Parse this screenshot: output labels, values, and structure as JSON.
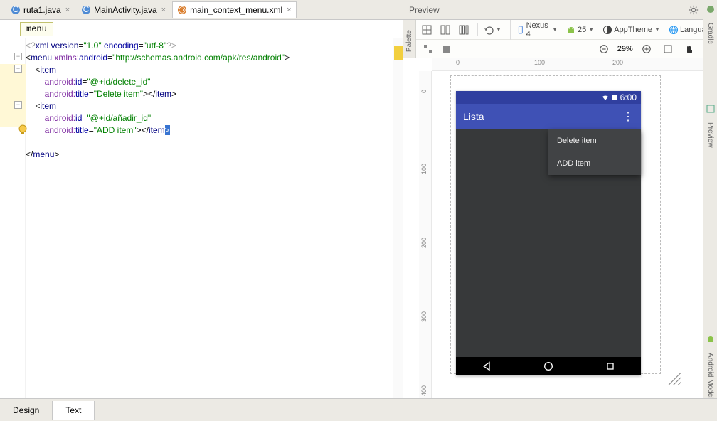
{
  "tabs": [
    {
      "label": "ruta1.java",
      "icon_hint": "class"
    },
    {
      "label": "MainActivity.java",
      "icon_hint": "class"
    },
    {
      "label": "main_context_menu.xml",
      "icon_hint": "xml"
    }
  ],
  "active_tab_index": 2,
  "breadcrumb": {
    "item": "menu"
  },
  "editor": {
    "selection_text": ">",
    "lines_tokens": [
      [
        {
          "cls": "t-pi",
          "t": "<?"
        },
        {
          "cls": "t-tag",
          "t": "xml version"
        },
        {
          "cls": "",
          "t": "="
        },
        {
          "cls": "t-str",
          "t": "\"1.0\""
        },
        {
          "cls": "",
          "t": " "
        },
        {
          "cls": "t-attr",
          "t": "encoding"
        },
        {
          "cls": "",
          "t": "="
        },
        {
          "cls": "t-str",
          "t": "\"utf-8\""
        },
        {
          "cls": "t-pi",
          "t": "?>"
        }
      ],
      [
        {
          "cls": "",
          "t": "<"
        },
        {
          "cls": "t-tag",
          "t": "menu "
        },
        {
          "cls": "t-ns",
          "t": "xmlns:"
        },
        {
          "cls": "t-attr",
          "t": "android"
        },
        {
          "cls": "",
          "t": "="
        },
        {
          "cls": "t-str",
          "t": "\"http://schemas.android.com/apk/res/android\""
        },
        {
          "cls": "",
          "t": ">"
        }
      ],
      [
        {
          "cls": "",
          "t": "    <"
        },
        {
          "cls": "t-tag",
          "t": "item"
        }
      ],
      [
        {
          "cls": "",
          "t": "        "
        },
        {
          "cls": "t-ns",
          "t": "android:"
        },
        {
          "cls": "t-attr",
          "t": "id"
        },
        {
          "cls": "",
          "t": "="
        },
        {
          "cls": "t-str",
          "t": "\"@+id/delete_id\""
        }
      ],
      [
        {
          "cls": "",
          "t": "        "
        },
        {
          "cls": "t-ns",
          "t": "android:"
        },
        {
          "cls": "t-attr",
          "t": "title"
        },
        {
          "cls": "",
          "t": "="
        },
        {
          "cls": "t-str",
          "t": "\"Delete item\""
        },
        {
          "cls": "",
          "t": "></"
        },
        {
          "cls": "t-tag",
          "t": "item"
        },
        {
          "cls": "",
          "t": ">"
        }
      ],
      [
        {
          "cls": "",
          "t": "    <"
        },
        {
          "cls": "t-tag",
          "t": "item"
        }
      ],
      [
        {
          "cls": "",
          "t": "        "
        },
        {
          "cls": "t-ns",
          "t": "android:"
        },
        {
          "cls": "t-attr",
          "t": "id"
        },
        {
          "cls": "",
          "t": "="
        },
        {
          "cls": "t-str",
          "t": "\"@+id/añadir_id\""
        }
      ],
      [
        {
          "cls": "",
          "t": "        "
        },
        {
          "cls": "t-ns",
          "t": "android:"
        },
        {
          "cls": "t-attr",
          "t": "title"
        },
        {
          "cls": "",
          "t": "="
        },
        {
          "cls": "t-str",
          "t": "\"ADD item\""
        },
        {
          "cls": "",
          "t": "></"
        },
        {
          "cls": "t-tag",
          "t": "item"
        },
        {
          "cls": "sel",
          "t": ">"
        }
      ],
      [
        {
          "cls": "",
          "t": ""
        }
      ],
      [
        {
          "cls": "",
          "t": "</"
        },
        {
          "cls": "t-tag",
          "t": "menu"
        },
        {
          "cls": "",
          "t": ">"
        }
      ]
    ],
    "highlight_rows": [
      2,
      3,
      4,
      5,
      6,
      7
    ],
    "warn_marks": [
      2,
      3,
      4,
      5,
      7
    ]
  },
  "bottom_tabs": {
    "design": "Design",
    "text": "Text",
    "active": "text"
  },
  "preview": {
    "title": "Preview",
    "device_label": "Nexus 4",
    "api_label": "25",
    "theme_label": "AppTheme",
    "language_label": "Language",
    "zoom_label": "29%",
    "ruler_h": [
      "0",
      "100",
      "200"
    ],
    "ruler_v": [
      "0",
      "100",
      "200",
      "300",
      "400"
    ],
    "status_time": "6:00",
    "app_title": "Lista",
    "menu_items": [
      "Delete item",
      "ADD item"
    ]
  },
  "side_rails": {
    "right_top": "Gradle",
    "right_mid": "Preview",
    "right_bottom": "Android Model",
    "palette": "Palette"
  }
}
